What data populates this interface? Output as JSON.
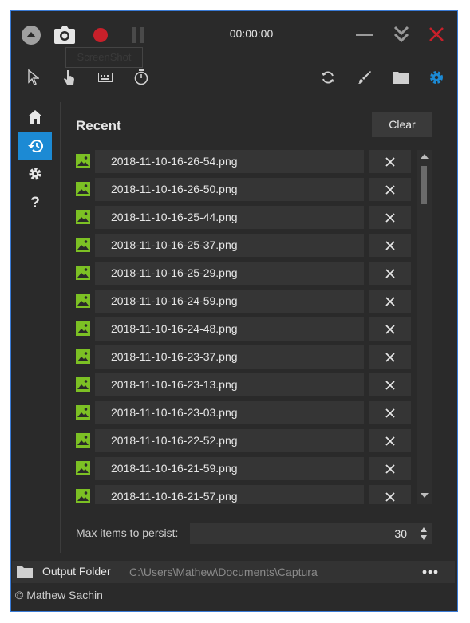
{
  "header": {
    "timer": "00:00:00",
    "tooltip": "ScreenShot"
  },
  "recent": {
    "title": "Recent",
    "clear_label": "Clear",
    "items": [
      "2018-11-10-16-26-54.png",
      "2018-11-10-16-26-50.png",
      "2018-11-10-16-25-44.png",
      "2018-11-10-16-25-37.png",
      "2018-11-10-16-25-29.png",
      "2018-11-10-16-24-59.png",
      "2018-11-10-16-24-48.png",
      "2018-11-10-16-23-37.png",
      "2018-11-10-16-23-13.png",
      "2018-11-10-16-23-03.png",
      "2018-11-10-16-22-52.png",
      "2018-11-10-16-21-59.png",
      "2018-11-10-16-21-57.png"
    ]
  },
  "settings": {
    "max_items_label": "Max items to persist:",
    "max_items_value": "30"
  },
  "output": {
    "label": "Output Folder",
    "path": "C:\\Users\\Mathew\\Documents\\Captura"
  },
  "footer": {
    "copyright": "© Mathew Sachin"
  },
  "colors": {
    "accent": "#1c8ad4",
    "record": "#c8202a",
    "close": "#c8202a",
    "image_icon": "#7cc024",
    "background": "#2a2a2a"
  }
}
